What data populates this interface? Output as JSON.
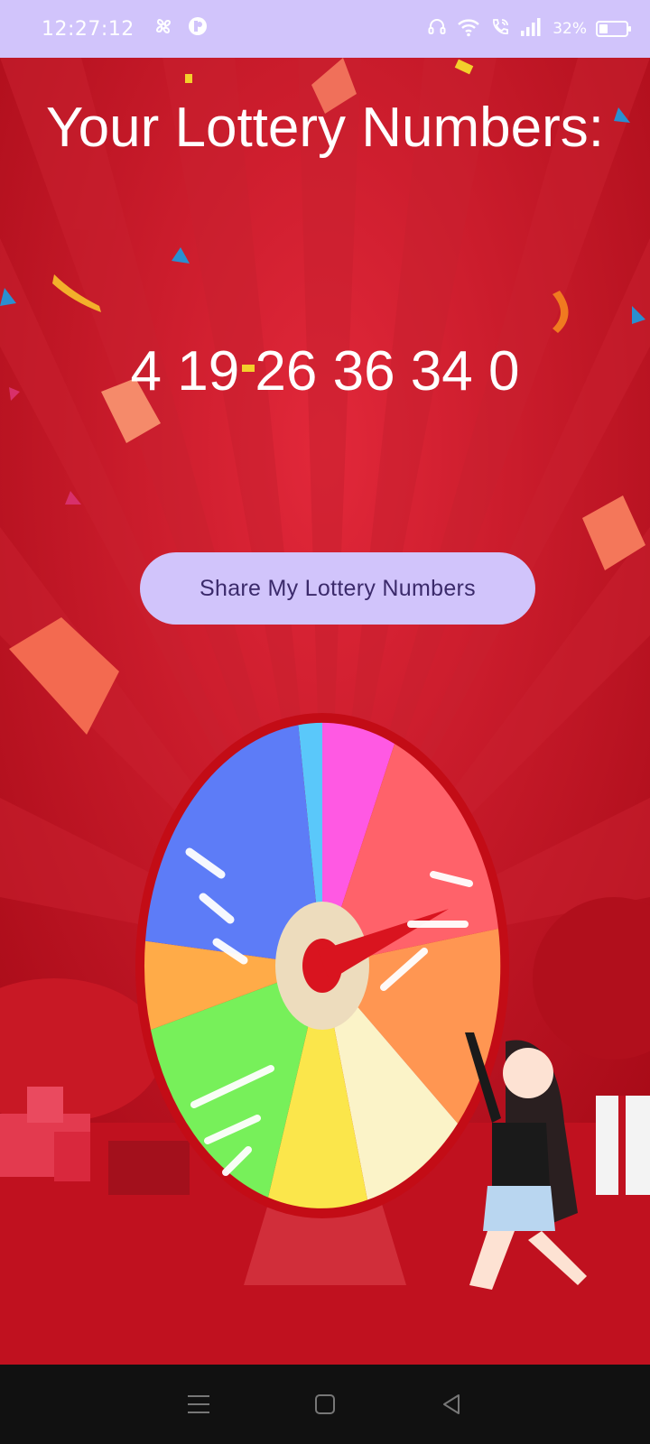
{
  "status_bar": {
    "time": "12:27:12",
    "battery_text": "32%",
    "battery_level": 0.32,
    "icons": [
      "fan-icon",
      "app-notification-icon",
      "headset-icon",
      "wifi-icon",
      "wifi-call-icon",
      "signal-icon",
      "battery-icon"
    ]
  },
  "main": {
    "title": "Your Lottery Numbers:",
    "numbers": "4 19 26 36 34 0",
    "share_button_label": "Share My Lottery Numbers"
  },
  "colors": {
    "accent": "#d1c4fb",
    "button_text": "#3b2a6b",
    "background_red": "#b80c1b"
  },
  "nav_bar": {
    "icons": [
      "menu-icon",
      "home-icon",
      "back-icon"
    ]
  }
}
